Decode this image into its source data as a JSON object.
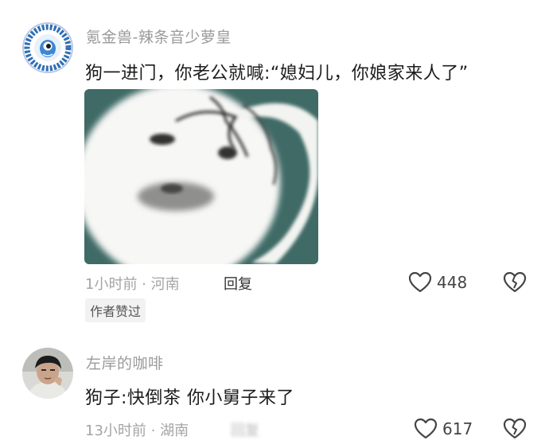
{
  "comments": [
    {
      "username": "氪金兽-辣条音少萝皇",
      "avatar_icon": "eye-monster-badge-avatar",
      "text": "狗一进门，你老公就喊:“媳妇儿，你娘家来人了”",
      "image_icon": "panda-face-meme-image",
      "meta": "1小时前 · 河南",
      "reply_label": "回复",
      "author_badge": "作者赞过",
      "like_count": "448",
      "like_icon": "heart-outline-icon",
      "dislike_icon": "broken-heart-icon"
    },
    {
      "username": "左岸的咖啡",
      "avatar_icon": "person-photo-avatar",
      "text": "狗子:快倒茶 你小舅子来了",
      "meta": "13小时前 · 湖南",
      "reply_label": "回复",
      "like_count": "617",
      "like_icon": "heart-outline-icon",
      "dislike_icon": "broken-heart-icon"
    }
  ],
  "colors": {
    "meme_background": "#3f6a66",
    "avatar_ring": "#2f6fb5"
  }
}
